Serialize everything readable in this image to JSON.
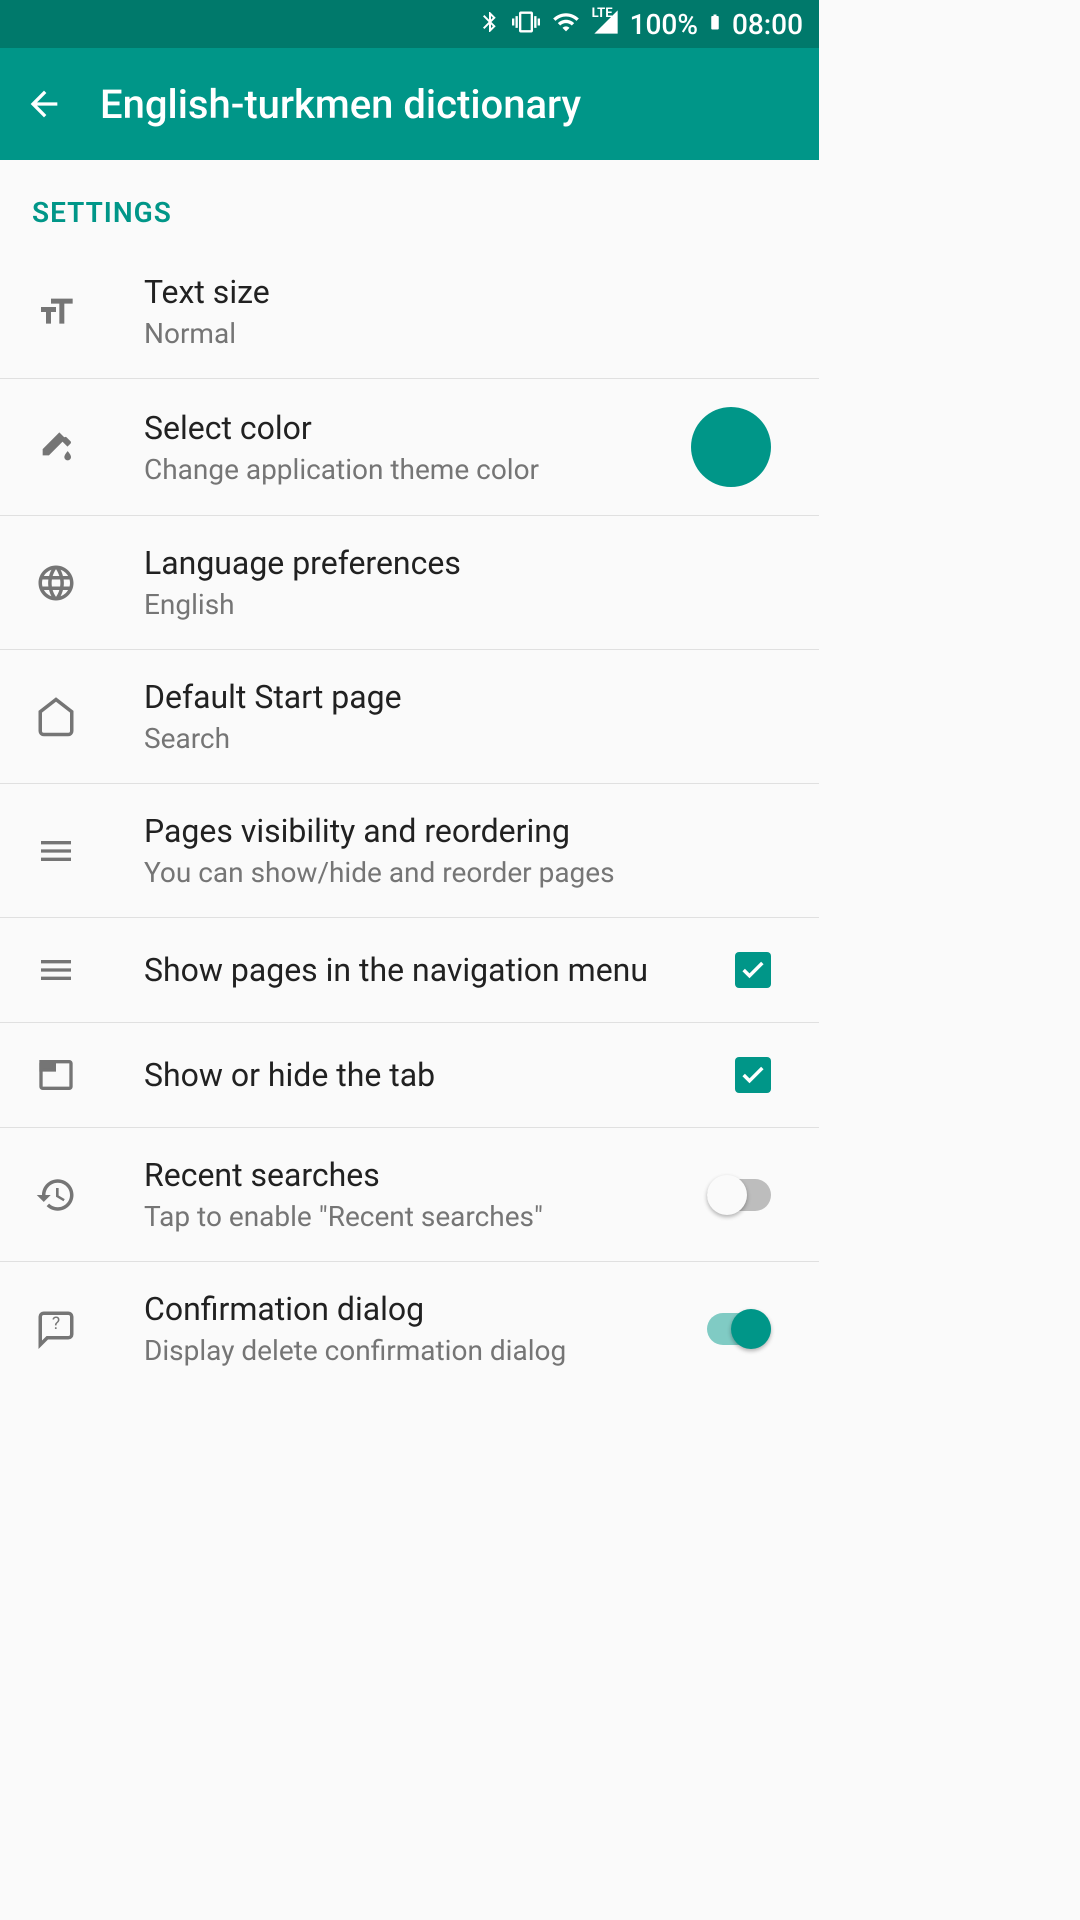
{
  "statusBar": {
    "battery": "100%",
    "time": "08:00",
    "lte": "LTE"
  },
  "appBar": {
    "title": "English-turkmen dictionary"
  },
  "sectionHeader": "SETTINGS",
  "settings": {
    "textSize": {
      "title": "Text size",
      "value": "Normal"
    },
    "selectColor": {
      "title": "Select color",
      "subtitle": "Change application theme color",
      "colorHex": "#009688"
    },
    "language": {
      "title": "Language preferences",
      "value": "English"
    },
    "startPage": {
      "title": "Default Start page",
      "value": "Search"
    },
    "pagesVisibility": {
      "title": "Pages visibility and reordering",
      "subtitle": "You can show/hide and reorder pages"
    },
    "showPagesNav": {
      "title": "Show pages in the navigation menu",
      "checked": true
    },
    "showHideTab": {
      "title": "Show or hide the tab",
      "checked": true
    },
    "recentSearches": {
      "title": "Recent searches",
      "subtitle": "Tap to enable \"Recent searches\"",
      "enabled": false
    },
    "confirmationDialog": {
      "title": "Confirmation dialog",
      "subtitle": "Display delete confirmation dialog",
      "enabled": true
    }
  }
}
